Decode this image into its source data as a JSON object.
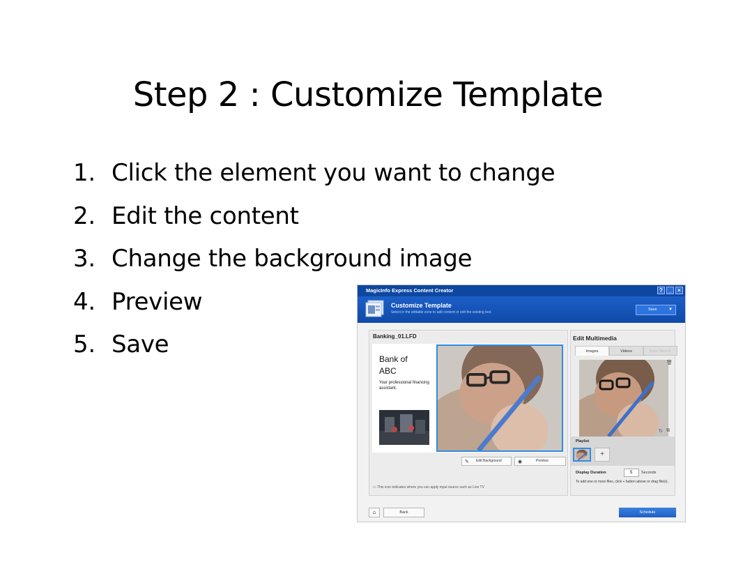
{
  "slide": {
    "title": "Step 2 : Customize Template",
    "steps": [
      {
        "num": "1.",
        "text": "Click the element you want to change"
      },
      {
        "num": "2.",
        "text": "Edit the content"
      },
      {
        "num": "3.",
        "text": "Change the background image"
      },
      {
        "num": "4.",
        "text": "Preview"
      },
      {
        "num": "5.",
        "text": "Save"
      }
    ]
  },
  "app": {
    "window_title": "MagicInfo Express Content Creator",
    "win_buttons": [
      "?",
      "_",
      "×"
    ],
    "header": {
      "title": "Customize Template",
      "subtitle": "Select in the editable zone to add content or edit the existing text.",
      "save_label": "Save",
      "save_caret": "▼"
    },
    "editor": {
      "file_name": "Banking_01.LFD",
      "bank_title": "Bank of ABC",
      "bank_subtitle": "Your professional financing assistant.",
      "edit_background_label": "Edit Background",
      "preview_label": "Preview",
      "note": "This icon indicates where you can apply input source such as Live TV"
    },
    "multimedia": {
      "title": "Edit Multimedia",
      "tabs": [
        "Images",
        "Videos",
        "Input Source"
      ],
      "playlist_label": "Playlist",
      "add_symbol": "+",
      "display_duration_label": "Display Duration",
      "display_duration_value": "5",
      "display_duration_unit": "Seconds",
      "add_files_note": "To add one or more files, click + button above or drag file(s)."
    },
    "footer": {
      "home_symbol": "⌂",
      "back_label": "Back",
      "schedule_label": "Schedule"
    }
  }
}
